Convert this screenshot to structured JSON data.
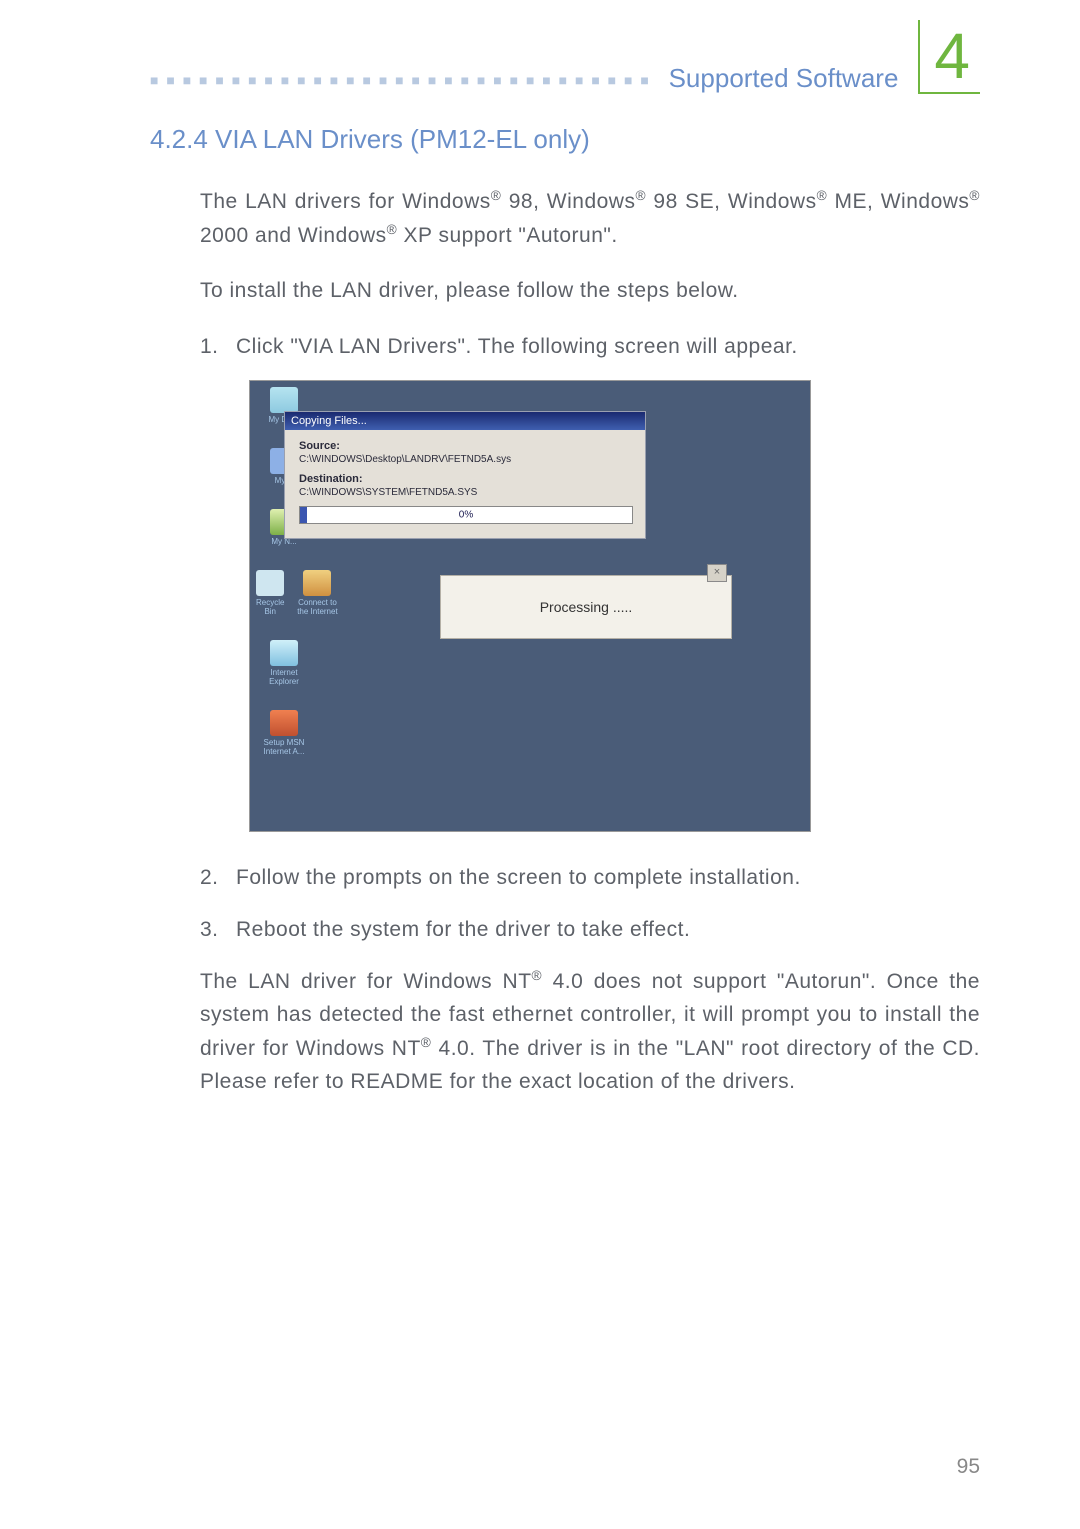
{
  "header": {
    "section": "Supported Software",
    "chapter": "4",
    "dots": "■ ■ ■ ■ ■ ■ ■ ■ ■ ■ ■ ■ ■ ■ ■ ■ ■ ■ ■ ■ ■ ■ ■ ■ ■ ■ ■ ■ ■ ■ ■ ■ ■ ■ ■ ■ ■ ■ ■ ■"
  },
  "title": "4.2.4 VIA LAN Drivers (PM12-EL only)",
  "intro1_a": "The LAN drivers for Windows",
  "intro1_b": " 98, Windows",
  "intro1_c": " 98 SE, Windows",
  "intro1_d": " ME, Windows",
  "intro1_e": " 2000 and Windows",
  "intro1_f": " XP support \"Autorun\".",
  "intro2": "To install the LAN driver, please follow the steps below.",
  "steps": [
    "Click \"VIA LAN Drivers\". The following screen will appear.",
    "Follow the prompts on the screen to complete installation.",
    "Reboot the system for the driver to take effect."
  ],
  "note_a": "The LAN driver for Windows NT",
  "note_b": " 4.0 does not support \"Autorun\". Once the system has detected the fast ethernet controller, it will prompt you to install the driver for Windows NT",
  "note_c": " 4.0. The driver is in the \"LAN\" root directory of the CD. Please refer to README for the exact location of the drivers.",
  "screenshot": {
    "desk": {
      "mydocs": "My Docs",
      "mycomp": "My C",
      "myplaces": "My N...",
      "recycle": "Recycle Bin",
      "connect": "Connect to the Internet",
      "ie": "Internet Explorer",
      "msn": "Setup MSN Internet A..."
    },
    "dialog": {
      "title": "Copying Files...",
      "source_label": "Source:",
      "source": "C:\\WINDOWS\\Desktop\\LANDRV\\FETND5A.sys",
      "dest_label": "Destination:",
      "dest": "C:\\WINDOWS\\SYSTEM\\FETND5A.SYS",
      "percent": "0%"
    },
    "subdialog": {
      "text": "Processing ....."
    }
  },
  "page_number": "95",
  "reg_symbol": "®"
}
